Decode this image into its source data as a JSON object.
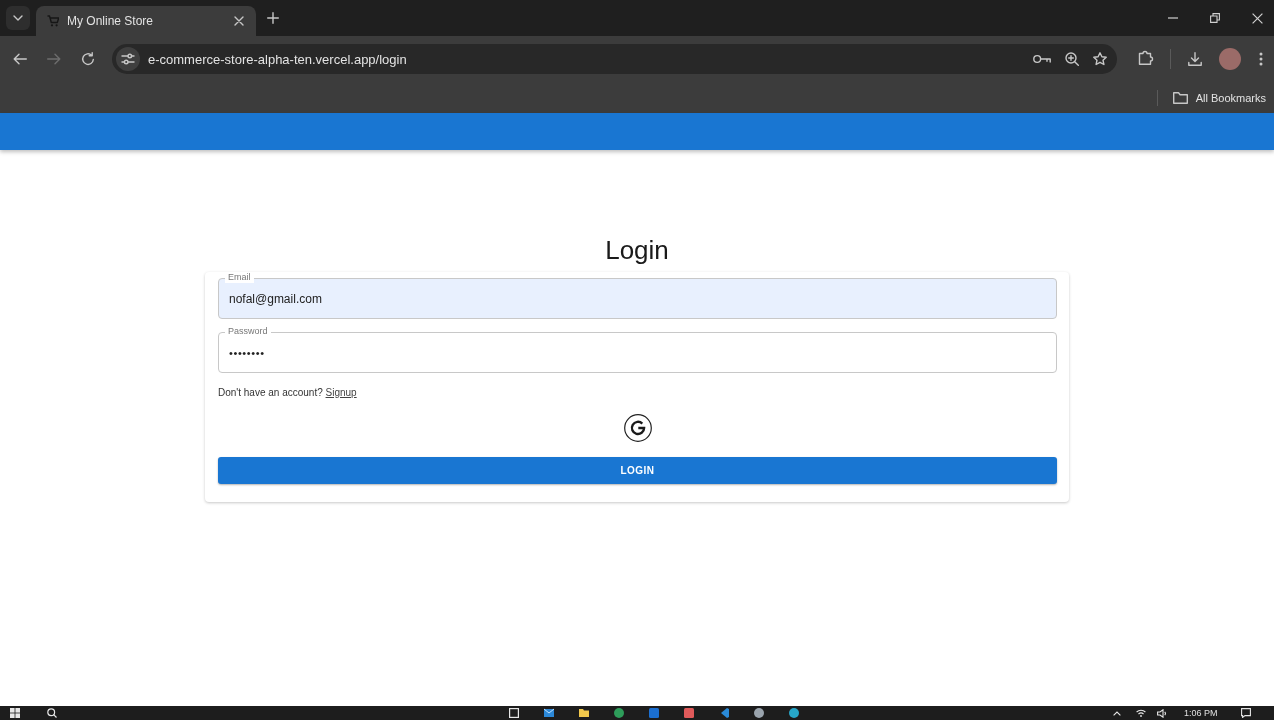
{
  "browser": {
    "tabs": [
      {
        "title": "My Online Store",
        "selected": true
      }
    ],
    "address": "e-commerce-store-alpha-ten.vercel.app/login",
    "bookmarks_folder": "All Bookmarks"
  },
  "login": {
    "title": "Login",
    "fields": [
      {
        "kind": "email",
        "label": "Email",
        "value": "nofal@gmail.com",
        "autofilled": true
      },
      {
        "kind": "password",
        "label": "Password",
        "value": "••••••••",
        "autofilled": false
      }
    ],
    "signup_prompt": "Don't have an account?",
    "signup_link": "Signup",
    "button": "LOGIN"
  },
  "taskbar": {
    "clock": "1:06 PM"
  }
}
